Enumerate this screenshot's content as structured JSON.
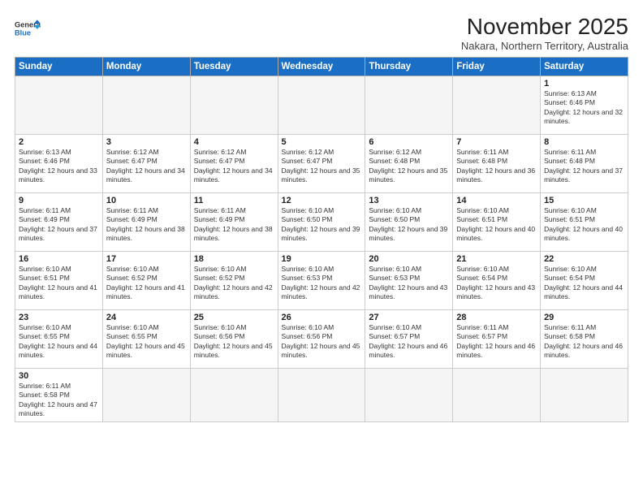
{
  "logo": {
    "line1": "General",
    "line2": "Blue"
  },
  "title": "November 2025",
  "subtitle": "Nakara, Northern Territory, Australia",
  "days_header": [
    "Sunday",
    "Monday",
    "Tuesday",
    "Wednesday",
    "Thursday",
    "Friday",
    "Saturday"
  ],
  "weeks": [
    [
      {
        "day": "",
        "info": ""
      },
      {
        "day": "",
        "info": ""
      },
      {
        "day": "",
        "info": ""
      },
      {
        "day": "",
        "info": ""
      },
      {
        "day": "",
        "info": ""
      },
      {
        "day": "",
        "info": ""
      },
      {
        "day": "1",
        "info": "Sunrise: 6:13 AM\nSunset: 6:46 PM\nDaylight: 12 hours and 32 minutes."
      }
    ],
    [
      {
        "day": "2",
        "info": "Sunrise: 6:13 AM\nSunset: 6:46 PM\nDaylight: 12 hours and 33 minutes."
      },
      {
        "day": "3",
        "info": "Sunrise: 6:12 AM\nSunset: 6:47 PM\nDaylight: 12 hours and 34 minutes."
      },
      {
        "day": "4",
        "info": "Sunrise: 6:12 AM\nSunset: 6:47 PM\nDaylight: 12 hours and 34 minutes."
      },
      {
        "day": "5",
        "info": "Sunrise: 6:12 AM\nSunset: 6:47 PM\nDaylight: 12 hours and 35 minutes."
      },
      {
        "day": "6",
        "info": "Sunrise: 6:12 AM\nSunset: 6:48 PM\nDaylight: 12 hours and 35 minutes."
      },
      {
        "day": "7",
        "info": "Sunrise: 6:11 AM\nSunset: 6:48 PM\nDaylight: 12 hours and 36 minutes."
      },
      {
        "day": "8",
        "info": "Sunrise: 6:11 AM\nSunset: 6:48 PM\nDaylight: 12 hours and 37 minutes."
      }
    ],
    [
      {
        "day": "9",
        "info": "Sunrise: 6:11 AM\nSunset: 6:49 PM\nDaylight: 12 hours and 37 minutes."
      },
      {
        "day": "10",
        "info": "Sunrise: 6:11 AM\nSunset: 6:49 PM\nDaylight: 12 hours and 38 minutes."
      },
      {
        "day": "11",
        "info": "Sunrise: 6:11 AM\nSunset: 6:49 PM\nDaylight: 12 hours and 38 minutes."
      },
      {
        "day": "12",
        "info": "Sunrise: 6:10 AM\nSunset: 6:50 PM\nDaylight: 12 hours and 39 minutes."
      },
      {
        "day": "13",
        "info": "Sunrise: 6:10 AM\nSunset: 6:50 PM\nDaylight: 12 hours and 39 minutes."
      },
      {
        "day": "14",
        "info": "Sunrise: 6:10 AM\nSunset: 6:51 PM\nDaylight: 12 hours and 40 minutes."
      },
      {
        "day": "15",
        "info": "Sunrise: 6:10 AM\nSunset: 6:51 PM\nDaylight: 12 hours and 40 minutes."
      }
    ],
    [
      {
        "day": "16",
        "info": "Sunrise: 6:10 AM\nSunset: 6:51 PM\nDaylight: 12 hours and 41 minutes."
      },
      {
        "day": "17",
        "info": "Sunrise: 6:10 AM\nSunset: 6:52 PM\nDaylight: 12 hours and 41 minutes."
      },
      {
        "day": "18",
        "info": "Sunrise: 6:10 AM\nSunset: 6:52 PM\nDaylight: 12 hours and 42 minutes."
      },
      {
        "day": "19",
        "info": "Sunrise: 6:10 AM\nSunset: 6:53 PM\nDaylight: 12 hours and 42 minutes."
      },
      {
        "day": "20",
        "info": "Sunrise: 6:10 AM\nSunset: 6:53 PM\nDaylight: 12 hours and 43 minutes."
      },
      {
        "day": "21",
        "info": "Sunrise: 6:10 AM\nSunset: 6:54 PM\nDaylight: 12 hours and 43 minutes."
      },
      {
        "day": "22",
        "info": "Sunrise: 6:10 AM\nSunset: 6:54 PM\nDaylight: 12 hours and 44 minutes."
      }
    ],
    [
      {
        "day": "23",
        "info": "Sunrise: 6:10 AM\nSunset: 6:55 PM\nDaylight: 12 hours and 44 minutes."
      },
      {
        "day": "24",
        "info": "Sunrise: 6:10 AM\nSunset: 6:55 PM\nDaylight: 12 hours and 45 minutes."
      },
      {
        "day": "25",
        "info": "Sunrise: 6:10 AM\nSunset: 6:56 PM\nDaylight: 12 hours and 45 minutes."
      },
      {
        "day": "26",
        "info": "Sunrise: 6:10 AM\nSunset: 6:56 PM\nDaylight: 12 hours and 45 minutes."
      },
      {
        "day": "27",
        "info": "Sunrise: 6:10 AM\nSunset: 6:57 PM\nDaylight: 12 hours and 46 minutes."
      },
      {
        "day": "28",
        "info": "Sunrise: 6:11 AM\nSunset: 6:57 PM\nDaylight: 12 hours and 46 minutes."
      },
      {
        "day": "29",
        "info": "Sunrise: 6:11 AM\nSunset: 6:58 PM\nDaylight: 12 hours and 46 minutes."
      }
    ],
    [
      {
        "day": "30",
        "info": "Sunrise: 6:11 AM\nSunset: 6:58 PM\nDaylight: 12 hours and 47 minutes."
      },
      {
        "day": "",
        "info": ""
      },
      {
        "day": "",
        "info": ""
      },
      {
        "day": "",
        "info": ""
      },
      {
        "day": "",
        "info": ""
      },
      {
        "day": "",
        "info": ""
      },
      {
        "day": "",
        "info": ""
      }
    ]
  ]
}
